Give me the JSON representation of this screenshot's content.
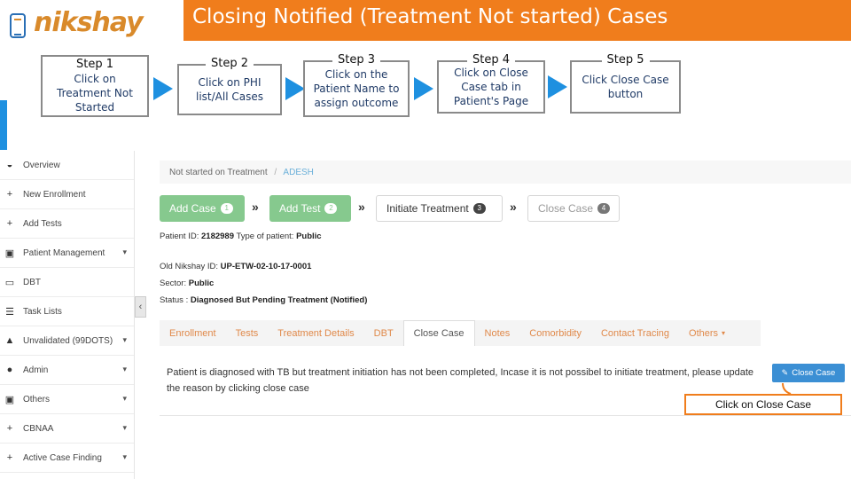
{
  "header": {
    "logo_text": "nikshay",
    "title": "Closing Notified (Treatment Not started) Cases"
  },
  "steps": [
    {
      "title": "Step 1",
      "text": "Click on Treatment Not Started"
    },
    {
      "title": "Step 2",
      "text": "Click on PHI list/All Cases"
    },
    {
      "title": "Step 3",
      "text": "Click on the Patient Name to assign outcome"
    },
    {
      "title": "Step 4",
      "text": "Click on Close Case tab in Patient's Page"
    },
    {
      "title": "Step 5",
      "text": "Click Close Case button"
    }
  ],
  "colors": {
    "accent": "#f07d1c",
    "arrow": "#1e90e0",
    "workflow_green": "#86c98e",
    "close_button": "#3b8fd4"
  },
  "sidebar": {
    "items": [
      {
        "label": "Overview",
        "icon": "dashboard-icon"
      },
      {
        "label": "New Enrollment",
        "icon": "plus-icon"
      },
      {
        "label": "Add Tests",
        "icon": "plus-icon"
      },
      {
        "label": "Patient Management",
        "icon": "briefcase-icon",
        "chevron": true
      },
      {
        "label": "DBT",
        "icon": "money-icon"
      },
      {
        "label": "Task Lists",
        "icon": "list-icon"
      },
      {
        "label": "Unvalidated (99DOTS)",
        "icon": "warning-icon",
        "chevron": true
      },
      {
        "label": "Admin",
        "icon": "user-icon",
        "chevron": true
      },
      {
        "label": "Others",
        "icon": "briefcase-icon",
        "chevron": true
      },
      {
        "label": "CBNAA",
        "icon": "plus-icon",
        "chevron": true
      },
      {
        "label": "Active Case Finding",
        "icon": "plus-icon",
        "chevron": true
      }
    ]
  },
  "breadcrumb": {
    "parent": "Not started on Treatment",
    "separator": "/",
    "current": "ADESH"
  },
  "workflow": {
    "add_case": {
      "label": "Add Case",
      "badge": "1"
    },
    "add_test": {
      "label": "Add Test",
      "badge": "2"
    },
    "initiate_treatment": {
      "label": "Initiate Treatment",
      "badge": "3"
    },
    "close_case": {
      "label": "Close Case",
      "badge": "4"
    }
  },
  "patient": {
    "id_label": "Patient ID:",
    "id": "2182989",
    "type_label": "Type of patient:",
    "type": "Public",
    "old_id_label": "Old Nikshay ID:",
    "old_id": "UP-ETW-02-10-17-0001",
    "sector_label": "Sector:",
    "sector": "Public",
    "status_label": "Status :",
    "status": "Diagnosed But Pending Treatment (Notified)"
  },
  "tabs": [
    "Enrollment",
    "Tests",
    "Treatment Details",
    "DBT",
    "Close Case",
    "Notes",
    "Comorbidity",
    "Contact Tracing",
    "Others"
  ],
  "active_tab": "Close Case",
  "close_case_panel": {
    "message": "Patient is diagnosed with TB but treatment initiation has not been completed, Incase it is not possibel to initiate treatment, please update the reason by clicking close case",
    "button_label": "Close Case"
  },
  "callout": "Click on Close Case"
}
